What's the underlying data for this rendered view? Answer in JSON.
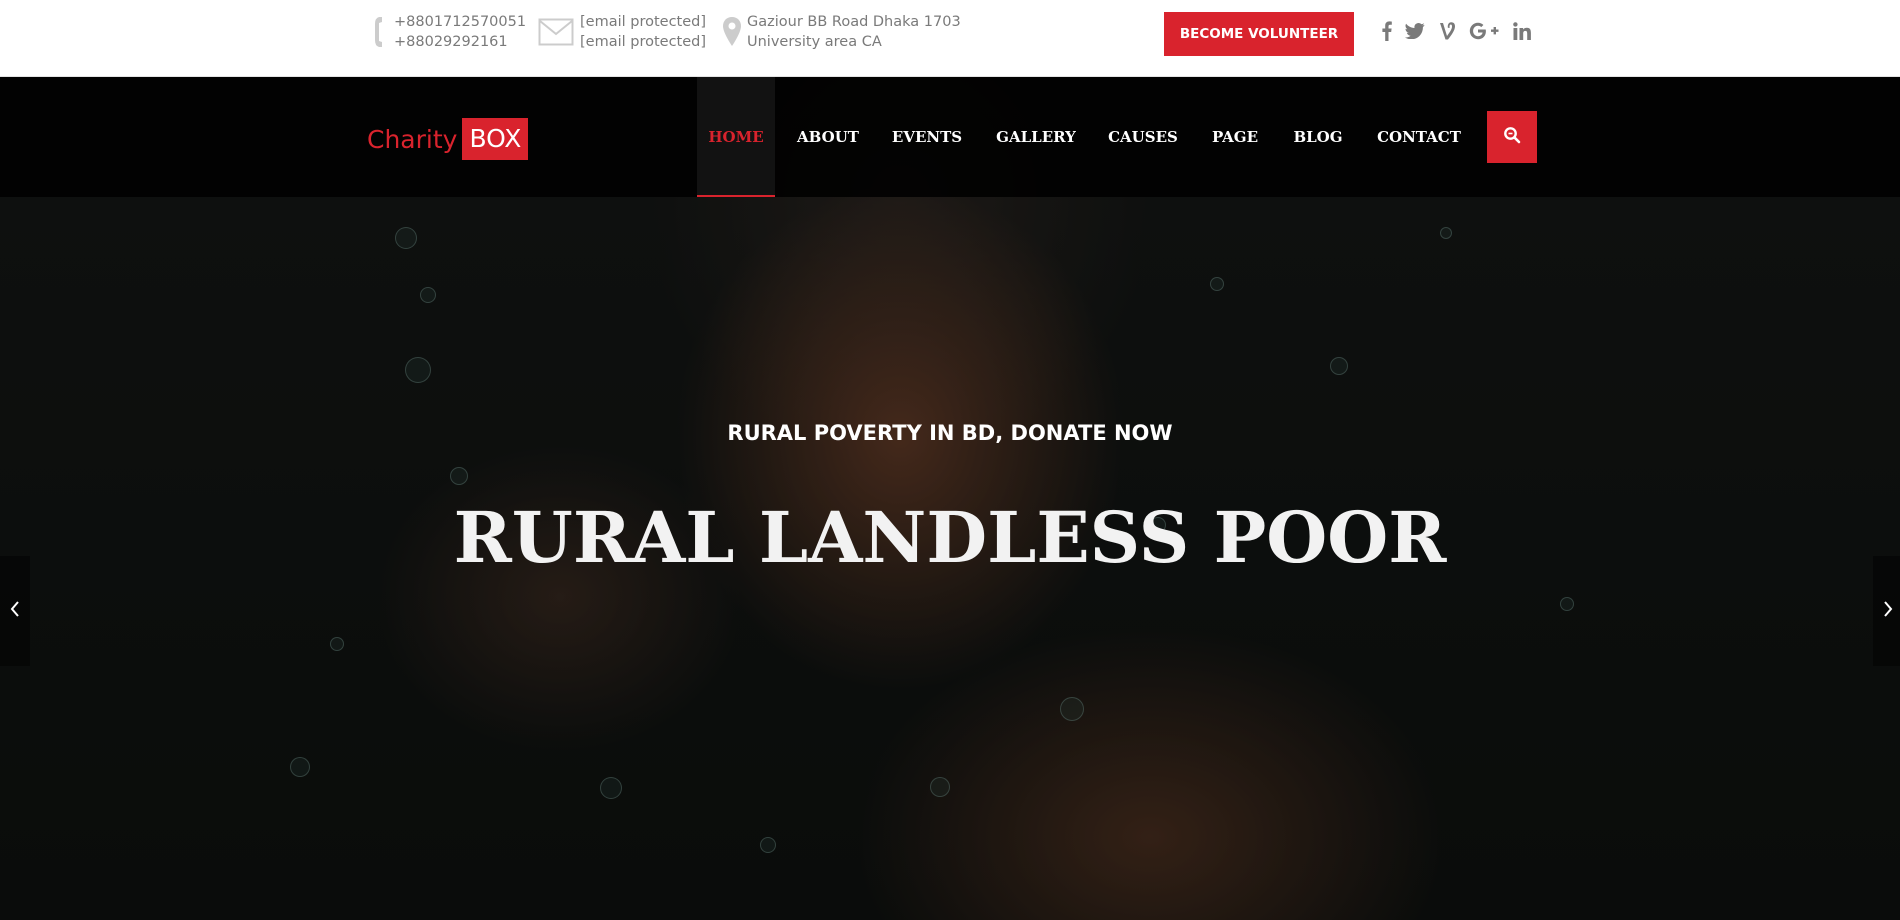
{
  "topbar": {
    "phone": {
      "icon": "phone-icon",
      "line1": "+8801712570051",
      "line2": "+88029292161"
    },
    "email": {
      "icon": "envelope-icon",
      "line1": "[email protected]",
      "line2": "[email protected]"
    },
    "address": {
      "icon": "map-pin-icon",
      "line1": "Gaziour BB Road Dhaka 1703",
      "line2": "University area CA"
    },
    "volunteer_label": "BECOME VOLUNTEER",
    "socials": [
      {
        "name": "facebook-icon",
        "glyph": "f"
      },
      {
        "name": "twitter-icon",
        "glyph": "t"
      },
      {
        "name": "vine-icon",
        "glyph": "v"
      },
      {
        "name": "google-plus-icon",
        "glyph": "G+"
      },
      {
        "name": "linkedin-icon",
        "glyph": "in"
      }
    ]
  },
  "logo": {
    "charity": "Charity",
    "box": "BOX"
  },
  "nav": {
    "items": [
      "HOME",
      "ABOUT",
      "EVENTS",
      "GALLERY",
      "CAUSES",
      "PAGE",
      "BLOG",
      "CONTACT"
    ],
    "active": "HOME",
    "search_icon": "search-icon"
  },
  "hero": {
    "subtitle": "RURAL POVERTY IN BD, DONATE NOW",
    "headline": "RURAL LANDLESS POOR",
    "prev_icon": "chevron-left-icon",
    "next_icon": "chevron-right-icon"
  },
  "colors": {
    "accent": "#d9232d",
    "topbar_text": "#7a7a7a",
    "nav_text": "#ffffff"
  }
}
